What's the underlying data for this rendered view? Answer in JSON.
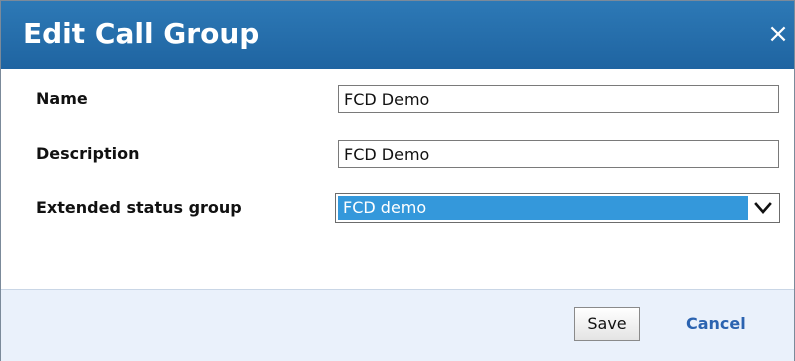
{
  "dialog": {
    "title": "Edit Call Group",
    "close_icon": "close-icon",
    "close_glyph": "×"
  },
  "form": {
    "name_label": "Name",
    "name_value": "FCD Demo",
    "description_label": "Description",
    "description_value": "FCD Demo",
    "extended_status_label": "Extended status group",
    "extended_status_value": "FCD demo",
    "extended_status_arrow_icon": "chevron-down-icon"
  },
  "footer": {
    "save_label": "Save",
    "cancel_label": "Cancel"
  },
  "colors": {
    "titlebar": "#1f64a1",
    "footer_bg": "#eaf1fb",
    "select_highlight": "#3498db",
    "link": "#2b63b0"
  }
}
